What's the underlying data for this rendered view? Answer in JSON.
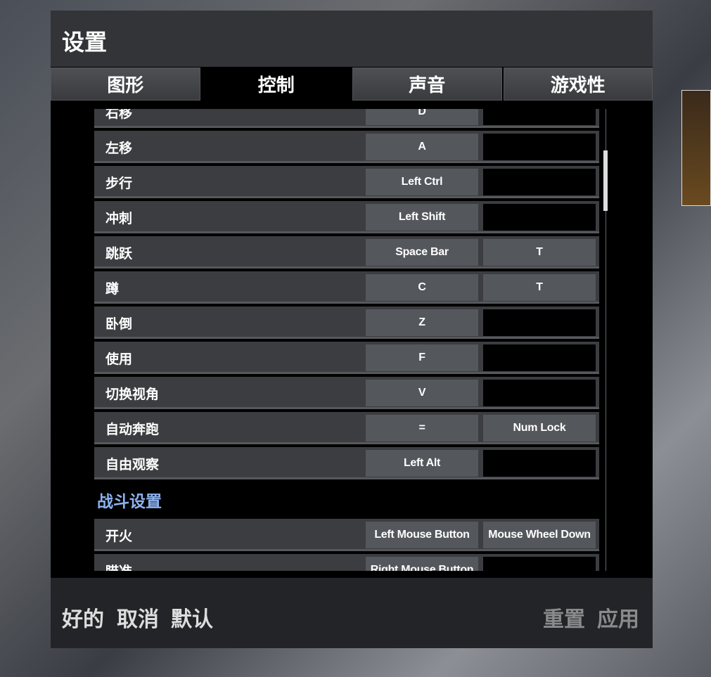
{
  "window": {
    "title": "设置"
  },
  "tabs": [
    {
      "label": "图形",
      "active": false
    },
    {
      "label": "控制",
      "active": true
    },
    {
      "label": "声音",
      "active": false
    },
    {
      "label": "游戏性",
      "active": false
    }
  ],
  "rows": [
    {
      "label": "右移",
      "key1": "D",
      "key2": ""
    },
    {
      "label": "左移",
      "key1": "A",
      "key2": ""
    },
    {
      "label": "步行",
      "key1": "Left Ctrl",
      "key2": ""
    },
    {
      "label": "冲刺",
      "key1": "Left Shift",
      "key2": ""
    },
    {
      "label": "跳跃",
      "key1": "Space Bar",
      "key2": "T"
    },
    {
      "label": "蹲",
      "key1": "C",
      "key2": "T"
    },
    {
      "label": "卧倒",
      "key1": "Z",
      "key2": ""
    },
    {
      "label": "使用",
      "key1": "F",
      "key2": ""
    },
    {
      "label": "切换视角",
      "key1": "V",
      "key2": ""
    },
    {
      "label": "自动奔跑",
      "key1": "=",
      "key2": "Num Lock"
    },
    {
      "label": "自由观察",
      "key1": "Left Alt",
      "key2": ""
    }
  ],
  "section": {
    "title": "战斗设置",
    "color": "#8cb2f0"
  },
  "combat_rows": [
    {
      "label": "开火",
      "key1": "Left Mouse Button",
      "key2": "Mouse Wheel Down"
    },
    {
      "label": "瞄准",
      "key1": "Right Mouse Button",
      "key2": ""
    }
  ],
  "footer": {
    "ok": "好的",
    "cancel": "取消",
    "default": "默认",
    "reset": "重置",
    "apply": "应用"
  }
}
